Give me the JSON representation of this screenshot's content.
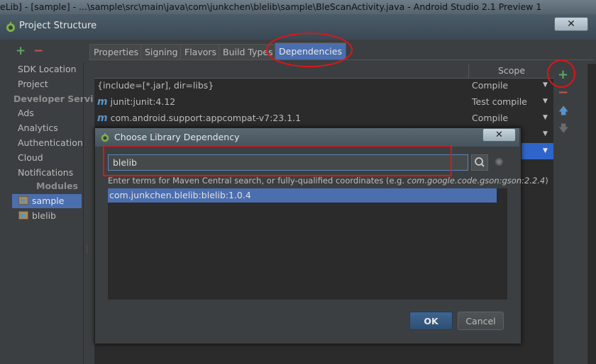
{
  "window_title": "eLib] - [sample] - ...\\sample\\src\\main\\java\\com\\junkchen\\blelib\\sample\\BleScanActivity.java - Android Studio 2.1 Preview 1",
  "project_structure": {
    "title": "Project Structure",
    "close_symbol": "✕",
    "toolbar": {
      "add": "+",
      "remove": "−"
    },
    "nav": {
      "items": [
        "SDK Location",
        "Project"
      ],
      "developer_services_header": "Developer Servi",
      "services": [
        "Ads",
        "Analytics",
        "Authentication",
        "Cloud",
        "Notifications"
      ],
      "modules_header": "Modules",
      "modules": [
        "sample",
        "blelib"
      ],
      "selected_module": "sample"
    },
    "tabs": [
      "Properties",
      "Signing",
      "Flavors",
      "Build Types",
      "Dependencies"
    ],
    "active_tab": "Dependencies",
    "table": {
      "scope_header": "Scope",
      "rows": [
        {
          "name": "{include=[*.jar], dir=libs}",
          "icon": "",
          "scope": "Compile"
        },
        {
          "name": "junit:junit:4.12",
          "icon": "m",
          "scope": "Test compile"
        },
        {
          "name": "com.android.support:appcompat-v7:23.1.1",
          "icon": "m",
          "scope": "Compile"
        }
      ]
    },
    "right_toolbar": {
      "add": "+",
      "remove": "−",
      "up": "🡅",
      "down": "🡇"
    }
  },
  "dialog": {
    "title": "Choose Library Dependency",
    "close_symbol": "✕",
    "search_value": "blelib",
    "hint_prefix": "Enter terms for Maven Central search, or fully-qualified coordinates (e.g. ",
    "hint_example": "com.google.code.gson:gson:2.2.4",
    "hint_suffix": ")",
    "results": [
      "com.junkchen.blelib:blelib:1.0.4"
    ],
    "ok_label": "OK",
    "cancel_label": "Cancel"
  },
  "colors": {
    "background": "#3c3f41",
    "panel_dark": "#2b2b2b",
    "selection": "#4b6eaf",
    "annotation_red": "#e0141a",
    "add_green": "#59a869",
    "remove_red": "#c75450"
  }
}
